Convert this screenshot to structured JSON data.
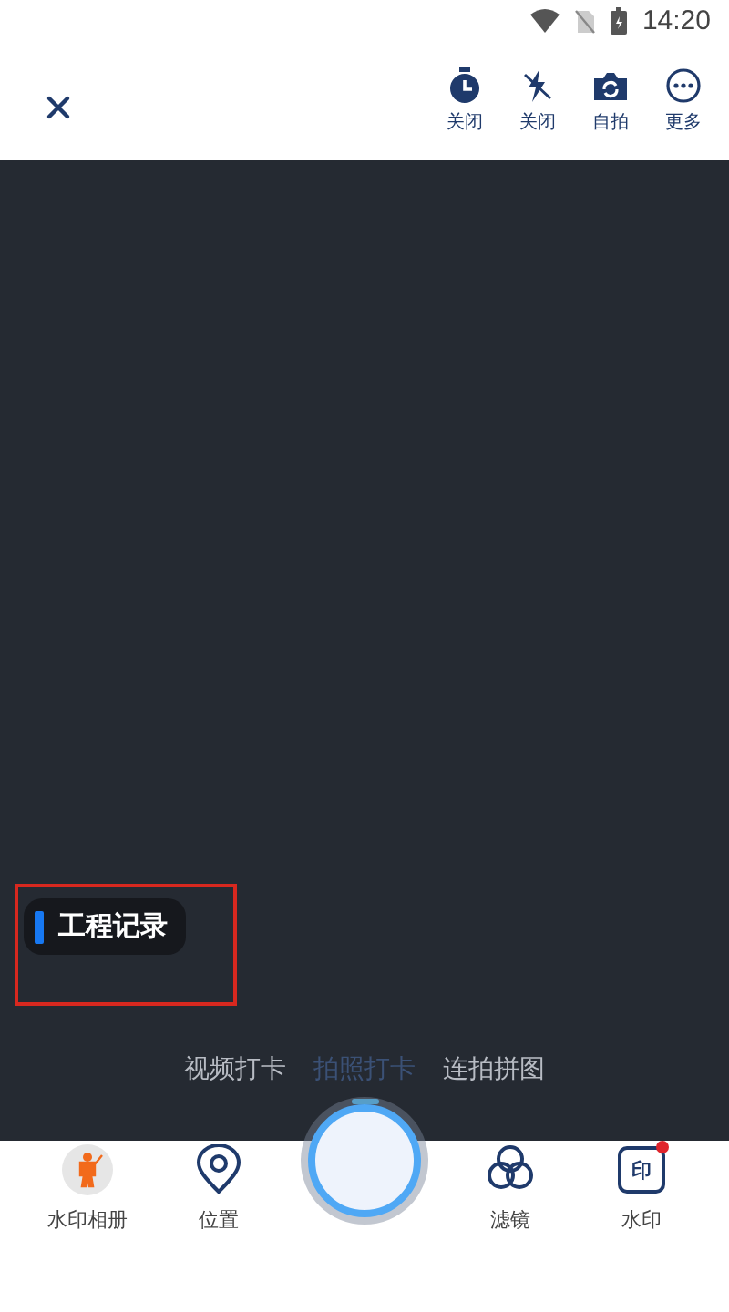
{
  "status_bar": {
    "time": "14:20"
  },
  "toolbar": {
    "actions": [
      {
        "kind": "timer",
        "label": "关闭"
      },
      {
        "kind": "flash",
        "label": "关闭"
      },
      {
        "kind": "flip",
        "label": "自拍"
      },
      {
        "kind": "more",
        "label": "更多"
      }
    ]
  },
  "watermark_tag": {
    "title": "工程记录",
    "highlighted": true
  },
  "modes": [
    {
      "label": "视频打卡",
      "selected": false
    },
    {
      "label": "拍照打卡",
      "selected": true
    },
    {
      "label": "连拍拼图",
      "selected": false
    }
  ],
  "bottom_bar": {
    "left": [
      {
        "kind": "album",
        "label": "水印相册"
      },
      {
        "kind": "location",
        "label": "位置"
      }
    ],
    "right": [
      {
        "kind": "filter",
        "label": "滤镜",
        "badge": false
      },
      {
        "kind": "stamp",
        "label": "水印",
        "icon_text": "印",
        "badge": true
      }
    ]
  }
}
